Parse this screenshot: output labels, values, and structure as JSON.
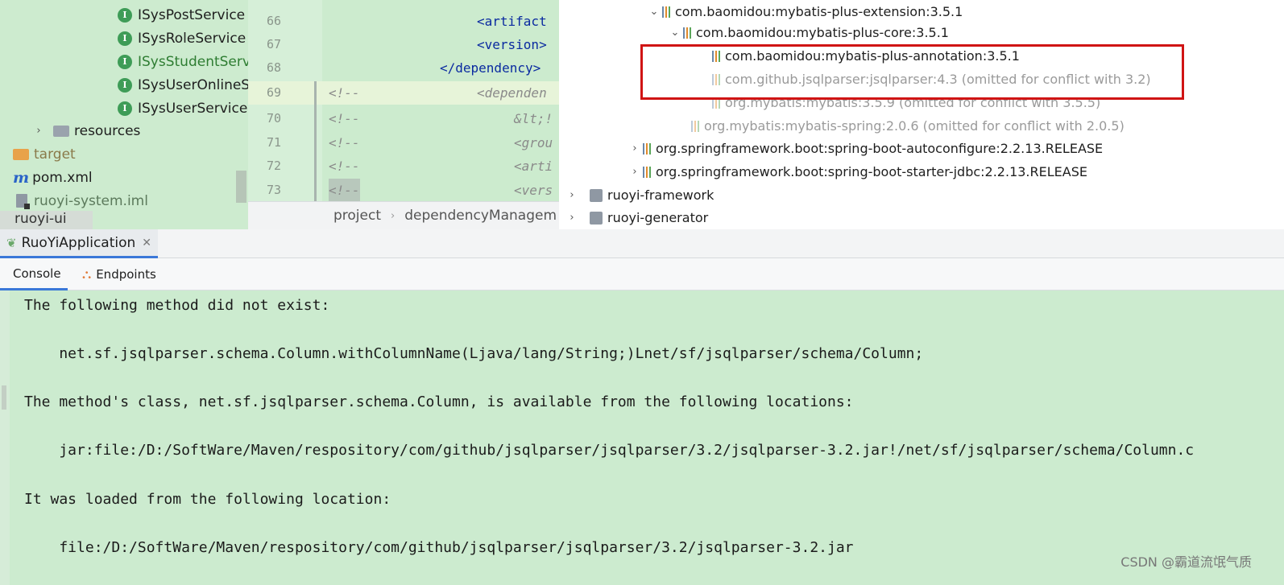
{
  "project_tree": {
    "items": [
      {
        "label": "ISysPostService",
        "icon": "interface-icon"
      },
      {
        "label": "ISysRoleService",
        "icon": "interface-icon"
      },
      {
        "label": "ISysStudentServ",
        "icon": "interface-icon",
        "color": "#2e7d32"
      },
      {
        "label": "ISysUserOnlineS",
        "icon": "interface-icon"
      },
      {
        "label": "ISysUserService",
        "icon": "interface-icon"
      },
      {
        "label": "resources",
        "icon": "folder-icon"
      },
      {
        "label": "target",
        "icon": "folder-icon"
      },
      {
        "label": "pom.xml",
        "icon": "maven-icon"
      },
      {
        "label": "ruoyi-system.iml",
        "icon": "iml-icon"
      },
      {
        "label": "ruoyi-ui",
        "icon": "module-icon"
      }
    ]
  },
  "editor": {
    "line_numbers": [
      "66",
      "67",
      "68",
      "69",
      "70",
      "71",
      "72",
      "73"
    ],
    "lines": [
      "<artifact",
      "<version>",
      "</dependency>",
      "<!--",
      "<dependen",
      "<!--",
      "&lt;!",
      "<!--",
      "<grou",
      "<!--",
      "<arti",
      "<!--",
      "<vers"
    ],
    "breadcrumb": [
      "project",
      "dependencyManagem"
    ]
  },
  "maven": {
    "deps": [
      {
        "label": "com.baomidou:mybatis-plus-extension:3.5.1"
      },
      {
        "label": "com.baomidou:mybatis-plus-core:3.5.1"
      },
      {
        "label": "com.baomidou:mybatis-plus-annotation:3.5.1"
      },
      {
        "label": "com.github.jsqlparser:jsqlparser:4.3 (omitted for conflict with 3.2)"
      },
      {
        "label": "org.mybatis:mybatis:3.5.9 (omitted for conflict with 3.5.5)"
      },
      {
        "label": "org.mybatis:mybatis-spring:2.0.6 (omitted for conflict with 2.0.5)"
      },
      {
        "label": "org.springframework.boot:spring-boot-autoconfigure:2.2.13.RELEASE"
      },
      {
        "label": "org.springframework.boot:spring-boot-starter-jdbc:2.2.13.RELEASE"
      },
      {
        "label": "ruoyi-framework"
      },
      {
        "label": "ruoyi-generator"
      }
    ]
  },
  "run": {
    "tab_label": "RuoYiApplication",
    "console_tab": "Console",
    "endpoints_tab": "Endpoints"
  },
  "console": {
    "lines": [
      "The following method did not exist:",
      "    net.sf.jsqlparser.schema.Column.withColumnName(Ljava/lang/String;)Lnet/sf/jsqlparser/schema/Column;",
      "The method's class, net.sf.jsqlparser.schema.Column, is available from the following locations:",
      "    jar:file:/D:/SoftWare/Maven/respository/com/github/jsqlparser/jsqlparser/3.2/jsqlparser-3.2.jar!/net/sf/jsqlparser/schema/Column.c",
      "It was loaded from the following location:",
      "    file:/D:/SoftWare/Maven/respository/com/github/jsqlparser/jsqlparser/3.2/jsqlparser-3.2.jar"
    ]
  },
  "watermark": "CSDN @霸道流氓气质",
  "colors": {
    "highlight_box": "#d01414",
    "console_bg": "#ccebcf",
    "accent": "#3b78d8"
  }
}
